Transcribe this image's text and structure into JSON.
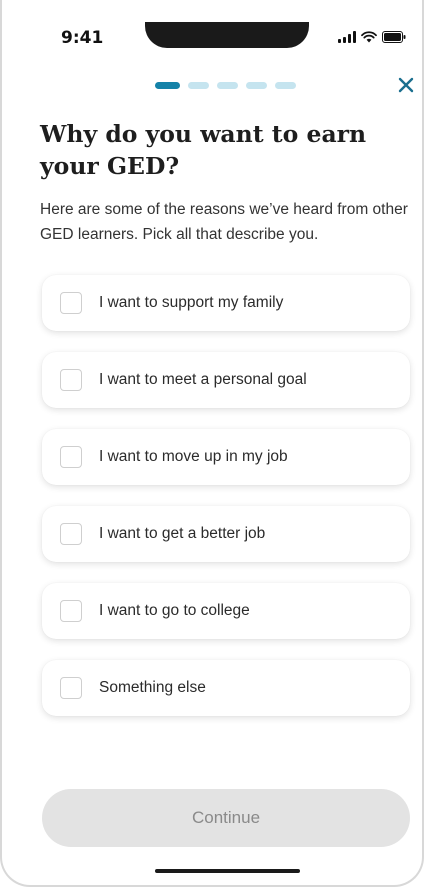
{
  "status_bar": {
    "time": "9:41",
    "icons": [
      "signal-icon",
      "wifi-icon",
      "battery-icon"
    ]
  },
  "progress": {
    "total_steps": 5,
    "current_step": 1,
    "active_color": "#1582a8",
    "inactive_color": "#c5e4ef"
  },
  "header": {
    "close_icon": "close-icon"
  },
  "main": {
    "title": "Why do you want to earn your GED?",
    "subtitle": "Here are some of the reasons we’ve heard from other GED learners. Pick all that describe you.",
    "options": [
      {
        "label": "I want to support my family",
        "checked": false
      },
      {
        "label": "I want to meet a personal goal",
        "checked": false
      },
      {
        "label": "I want to move up in my job",
        "checked": false
      },
      {
        "label": "I want to get a better job",
        "checked": false
      },
      {
        "label": "I want to go to college",
        "checked": false
      },
      {
        "label": "Something else",
        "checked": false
      }
    ]
  },
  "footer": {
    "continue_label": "Continue",
    "continue_enabled": false
  }
}
